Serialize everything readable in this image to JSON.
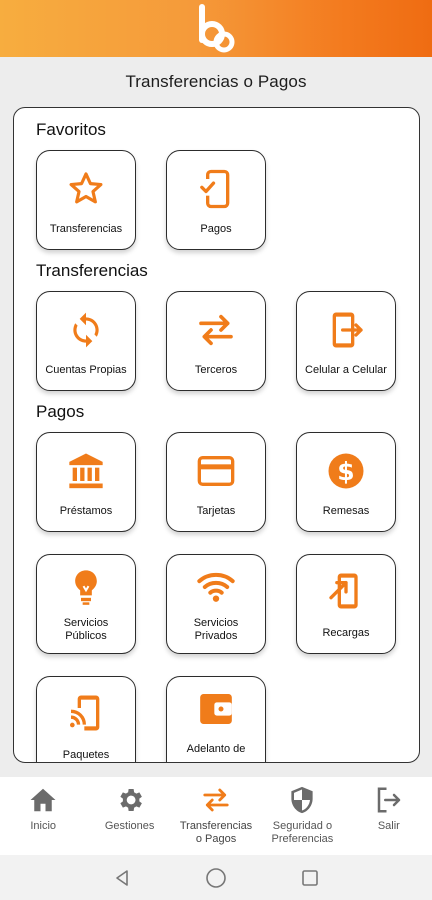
{
  "header": {
    "logo_icon": "brand-logo-b"
  },
  "page": {
    "title": "Transferencias o Pagos"
  },
  "sections": {
    "favoritos": {
      "title": "Favoritos",
      "items": [
        {
          "label": "Transferencias",
          "icon": "star-icon"
        },
        {
          "label": "Pagos",
          "icon": "phone-check-icon"
        }
      ]
    },
    "transferencias": {
      "title": "Transferencias",
      "items": [
        {
          "label": "Cuentas Propias",
          "icon": "sync-icon"
        },
        {
          "label": "Terceros",
          "icon": "swap-arrows-icon"
        },
        {
          "label": "Celular a Celular",
          "icon": "phone-exit-icon"
        }
      ]
    },
    "pagos": {
      "title": "Pagos",
      "items": [
        {
          "label": "Préstamos",
          "icon": "bank-icon"
        },
        {
          "label": "Tarjetas",
          "icon": "credit-card-icon"
        },
        {
          "label": "Remesas",
          "icon": "dollar-coin-icon"
        },
        {
          "label": "Servicios Públicos",
          "label_line1": "Servicios",
          "label_line2": "Públicos",
          "icon": "lightbulb-icon"
        },
        {
          "label": "Servicios Privados",
          "label_line1": "Servicios",
          "label_line2": "Privados",
          "icon": "wifi-icon"
        },
        {
          "label": "Recargas",
          "icon": "phone-arrow-icon"
        },
        {
          "label": "Paquetes",
          "icon": "phone-cast-icon"
        },
        {
          "label": "Adelanto de",
          "icon": "wallet-icon"
        }
      ]
    }
  },
  "bottom_nav": [
    {
      "label": "Inicio",
      "icon": "home-icon"
    },
    {
      "label": "Gestiones",
      "icon": "gear-icon"
    },
    {
      "label_line1": "Transferencias",
      "label_line2": "o Pagos",
      "icon": "swap-arrows-icon",
      "active": true
    },
    {
      "label_line1": "Seguridad o",
      "label_line2": "Preferencias",
      "icon": "shield-icon"
    },
    {
      "label": "Salir",
      "icon": "logout-icon"
    }
  ],
  "colors": {
    "accent": "#f07c1a",
    "header_start": "#f7ad3f",
    "header_end": "#ef6c12",
    "nav_icon": "#6b6b6b"
  }
}
